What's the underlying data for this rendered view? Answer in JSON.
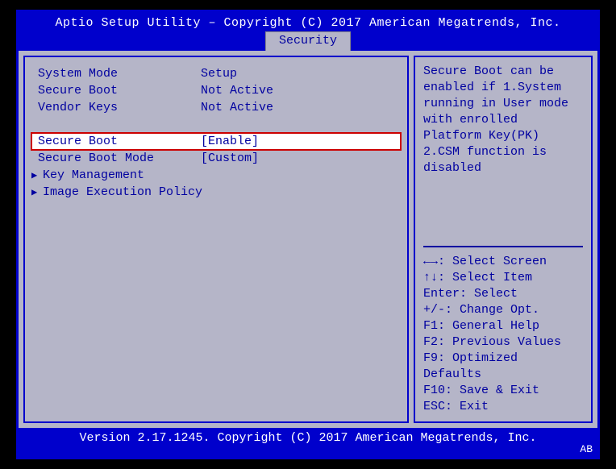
{
  "header": {
    "title": "Aptio Setup Utility – Copyright (C) 2017 American Megatrends, Inc.",
    "tab": "Security"
  },
  "info": {
    "system_mode_label": "System Mode",
    "system_mode_value": "Setup",
    "secure_boot_status_label": "Secure Boot",
    "secure_boot_status_value": "Not Active",
    "vendor_keys_label": "Vendor Keys",
    "vendor_keys_value": "Not Active"
  },
  "settings": {
    "secure_boot_label": "Secure Boot",
    "secure_boot_value": "[Enable]",
    "secure_boot_mode_label": "Secure Boot Mode",
    "secure_boot_mode_value": "[Custom]",
    "key_management_label": "Key Management",
    "image_exec_label": "Image Execution Policy"
  },
  "help": {
    "text": "Secure Boot can be enabled if 1.System running in User mode with enrolled Platform Key(PK) 2.CSM function is disabled"
  },
  "nav": {
    "select_screen": "←→: Select Screen",
    "select_item": "↑↓: Select Item",
    "enter": "Enter: Select",
    "change": "+/-: Change Opt.",
    "f1": "F1: General Help",
    "f2": "F2: Previous Values",
    "f9": "F9: Optimized Defaults",
    "f10": "F10: Save & Exit",
    "esc": "ESC: Exit"
  },
  "footer": {
    "text": "Version 2.17.1245. Copyright (C) 2017 American Megatrends, Inc.",
    "corner": "AB"
  }
}
